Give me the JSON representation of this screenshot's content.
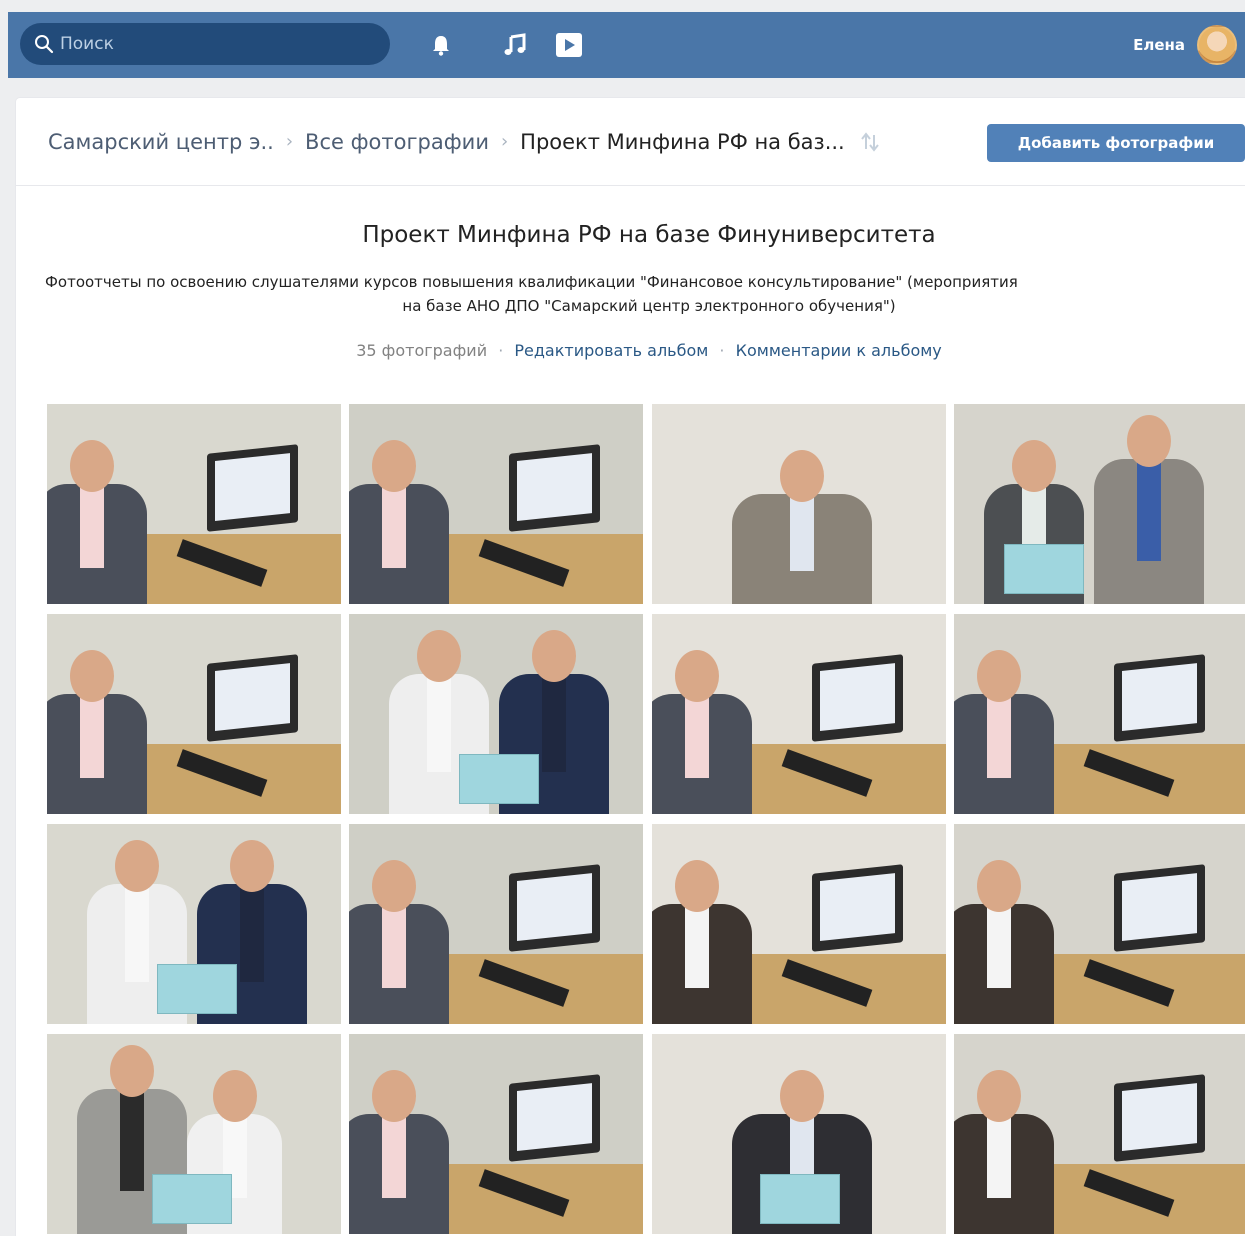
{
  "header": {
    "search_placeholder": "Поиск",
    "user_name": "Елена",
    "icons": [
      "search-icon",
      "bell-icon",
      "music-icon",
      "video-icon"
    ]
  },
  "breadcrumbs": {
    "items": [
      "Самарский центр э..",
      "Все фотографии",
      "Проект Минфина РФ на баз..."
    ],
    "add_button": "Добавить фотографии"
  },
  "album": {
    "title": "Проект Минфина РФ на базе Финуниверситета",
    "description_line1": "Фотоотчеты по освоению слушателями курсов повышения квалификации \"Финансовое консультирование\" (мероприятия",
    "description_line2": "на базе АНО ДПО \"Самарский центр электронного обучения\")",
    "count": "35 фотографий",
    "edit_link": "Редактировать альбом",
    "comments_link": "Комментарии к альбому"
  },
  "colors": {
    "header_bg": "#4a76a8",
    "search_bg": "#224b7a",
    "button_bg": "#5181b8",
    "link": "#2a5885",
    "page_bg": "#edeef0"
  },
  "photos": [
    {
      "scene": "man-at-computer"
    },
    {
      "scene": "man-at-computer-back"
    },
    {
      "scene": "portrait-man-suit"
    },
    {
      "scene": "woman-man-certificate"
    },
    {
      "scene": "man-at-computer"
    },
    {
      "scene": "two-men-certificate"
    },
    {
      "scene": "man-at-computer-back"
    },
    {
      "scene": "man-at-computer"
    },
    {
      "scene": "two-men-certificate"
    },
    {
      "scene": "man-at-computer-back"
    },
    {
      "scene": "woman-at-computer"
    },
    {
      "scene": "woman-at-computer"
    },
    {
      "scene": "man-woman-certificate"
    },
    {
      "scene": "man-at-computer-back"
    },
    {
      "scene": "portrait-man-certificate"
    },
    {
      "scene": "woman-at-computer"
    }
  ]
}
